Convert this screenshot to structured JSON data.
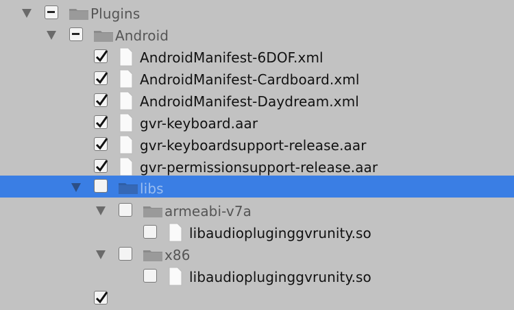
{
  "tree": {
    "plugins": {
      "label": "Plugins",
      "state": "mixed",
      "expanded": true
    },
    "android": {
      "label": "Android",
      "state": "mixed",
      "expanded": true
    },
    "files": [
      {
        "label": "AndroidManifest-6DOF.xml",
        "checked": true
      },
      {
        "label": "AndroidManifest-Cardboard.xml",
        "checked": true
      },
      {
        "label": "AndroidManifest-Daydream.xml",
        "checked": true
      },
      {
        "label": "gvr-keyboard.aar",
        "checked": true
      },
      {
        "label": "gvr-keyboardsupport-release.aar",
        "checked": true
      },
      {
        "label": "gvr-permissionsupport-release.aar",
        "checked": true
      }
    ],
    "libs": {
      "label": "libs",
      "checked": false,
      "expanded": true,
      "selected": true
    },
    "armeabi": {
      "label": "armeabi-v7a",
      "checked": false,
      "expanded": true
    },
    "armeabi_file": {
      "label": "libaudiopluginggvrunity.so",
      "checked": false
    },
    "x86": {
      "label": "x86",
      "checked": false,
      "expanded": true
    },
    "x86_file": {
      "label": "libaudiopluginggvrunity.so",
      "checked": false
    }
  },
  "colors": {
    "background": "#c2c2c2",
    "selection": "#3a7ee4"
  }
}
